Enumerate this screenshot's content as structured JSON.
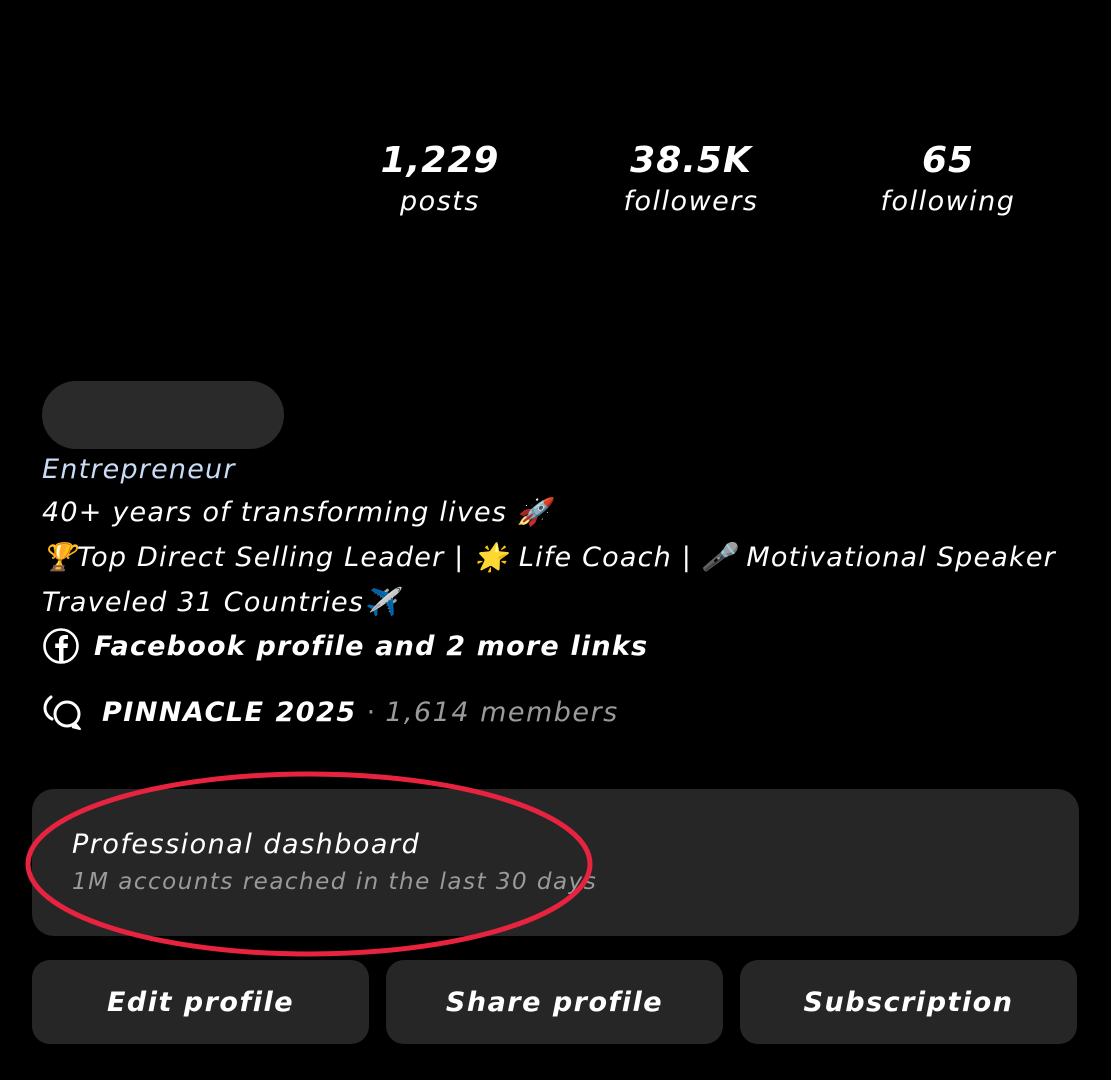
{
  "stats": {
    "posts": {
      "value": "1,229",
      "label": "posts"
    },
    "followers": {
      "value": "38.5K",
      "label": "followers"
    },
    "following": {
      "value": "65",
      "label": "following"
    }
  },
  "bio": {
    "category": "Entrepreneur",
    "line1": "40+ years of transforming lives 🚀",
    "line2": "🏆Top Direct Selling Leader | 🌟 Life Coach | 🎤 Motivational Speaker",
    "line3": "Traveled 31 Countries✈️",
    "link_text": "Facebook profile and 2 more links"
  },
  "channel": {
    "name": "PINNACLE 2025",
    "separator": "·",
    "members": "1,614 members"
  },
  "dashboard": {
    "title": "Professional dashboard",
    "subtitle": "1M accounts reached in the last 30 days"
  },
  "buttons": {
    "edit": "Edit profile",
    "share": "Share profile",
    "subscription": "Subscription"
  },
  "colors": {
    "background": "#000000",
    "card": "#262626",
    "highlight_ring": "#e8233f",
    "category_text": "#c8dcf5",
    "muted_text": "#9a9a9a"
  },
  "icons": {
    "link": "facebook-icon",
    "channel": "broadcast-chat-icon"
  }
}
